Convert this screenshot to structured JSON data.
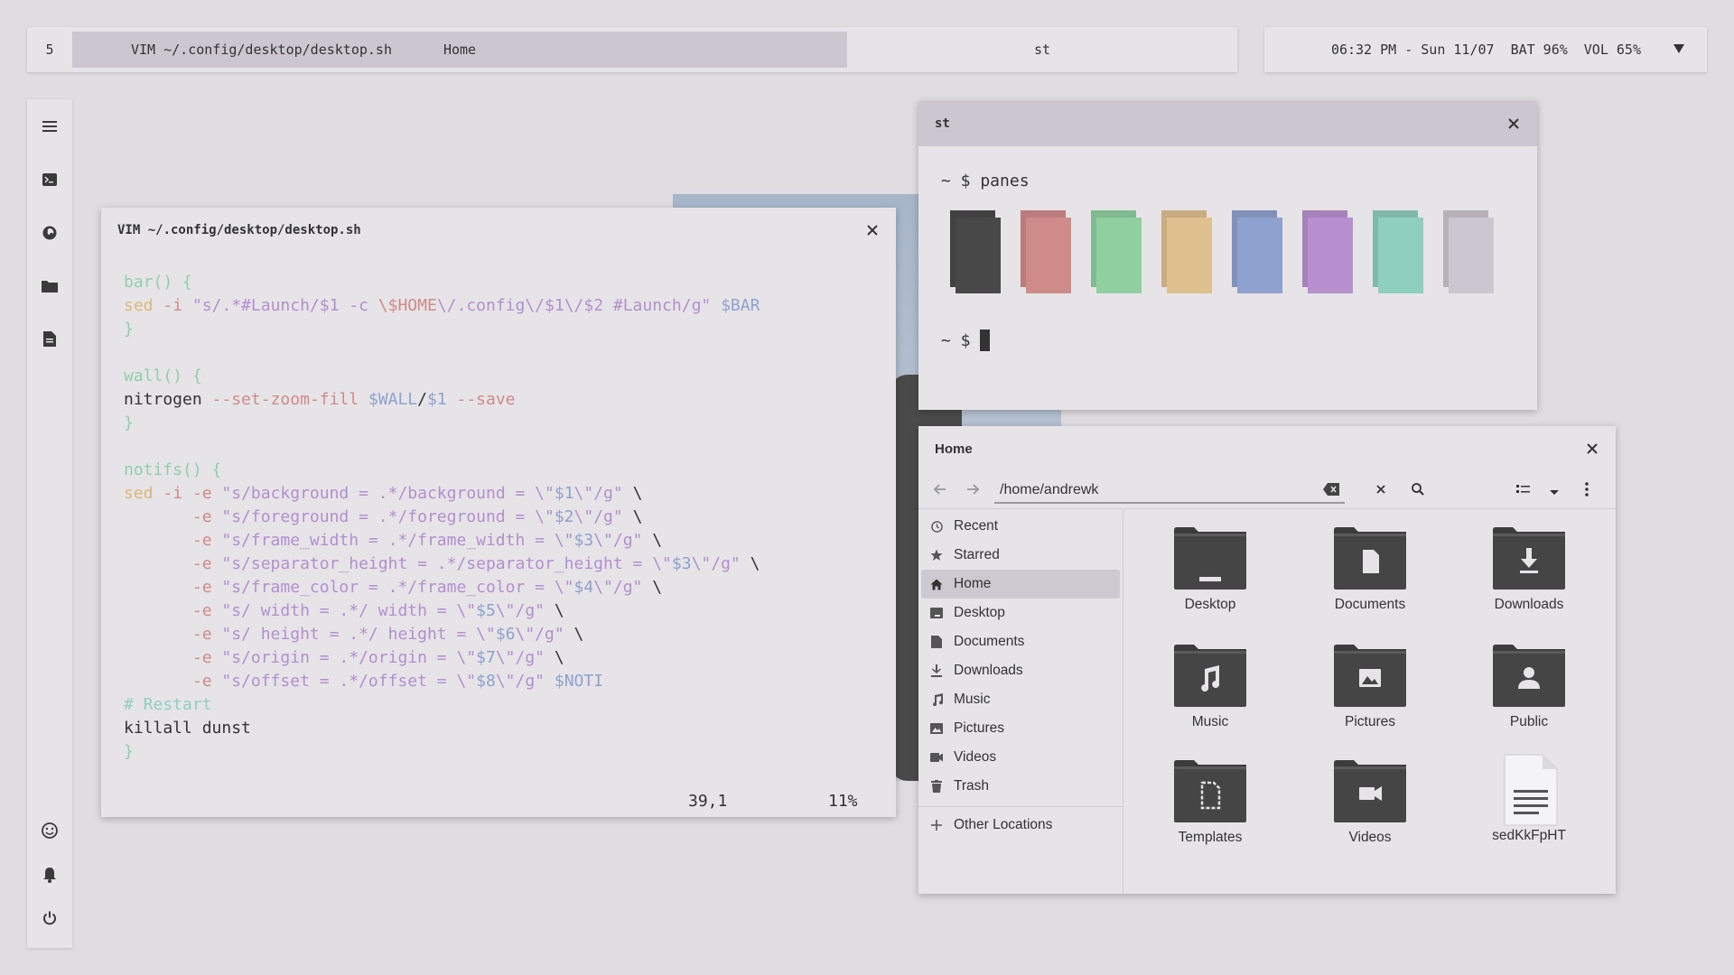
{
  "topbar": {
    "workspace": "5",
    "active_tab_left": "VIM ~/.config/desktop/desktop.sh",
    "active_tab_center": "Home",
    "tab_st": "st"
  },
  "status": {
    "datetime": "06:32 PM - Sun 11/07",
    "battery": "BAT 96%",
    "volume": "VOL 65%"
  },
  "dock": {
    "icons": [
      "menu-icon",
      "terminal-icon",
      "firefox-icon",
      "folder-icon",
      "document-icon",
      "emoji-icon",
      "bell-icon",
      "power-icon"
    ]
  },
  "vim": {
    "title": "VIM ~/.config/desktop/desktop.sh",
    "position": "39,1",
    "percent": "11%",
    "lines": [
      {
        "parts": [
          {
            "c": "green",
            "t": "bar() {"
          }
        ]
      },
      {
        "parts": [
          {
            "c": "orange",
            "t": "sed "
          },
          {
            "c": "red",
            "t": "-i "
          },
          {
            "c": "purple",
            "t": "\"s/.*#Launch/$1 -c "
          },
          {
            "c": "red",
            "t": "\\$HOME"
          },
          {
            "c": "purple",
            "t": "\\/.config\\/$1\\/$2 #Launch/g\" "
          },
          {
            "c": "blue",
            "t": "$BAR"
          }
        ]
      },
      {
        "parts": [
          {
            "c": "green",
            "t": "}"
          }
        ]
      },
      {
        "parts": [
          {
            "c": "dark",
            "t": ""
          }
        ]
      },
      {
        "parts": [
          {
            "c": "green",
            "t": "wall() {"
          }
        ]
      },
      {
        "parts": [
          {
            "c": "dark",
            "t": "nitrogen "
          },
          {
            "c": "red",
            "t": "--set-zoom-fill "
          },
          {
            "c": "blue",
            "t": "$WALL"
          },
          {
            "c": "dark",
            "t": "/"
          },
          {
            "c": "blue",
            "t": "$1 "
          },
          {
            "c": "red",
            "t": "--save"
          }
        ]
      },
      {
        "parts": [
          {
            "c": "green",
            "t": "}"
          }
        ]
      },
      {
        "parts": [
          {
            "c": "dark",
            "t": ""
          }
        ]
      },
      {
        "parts": [
          {
            "c": "green",
            "t": "notifs() {"
          }
        ]
      },
      {
        "parts": [
          {
            "c": "orange",
            "t": "sed "
          },
          {
            "c": "red",
            "t": "-i -e "
          },
          {
            "c": "purple",
            "t": "\"s/background = .*/background = \\\""
          },
          {
            "c": "blue",
            "t": "$1"
          },
          {
            "c": "purple",
            "t": "\\\"/g\" "
          },
          {
            "c": "dark",
            "t": "\\"
          }
        ]
      },
      {
        "parts": [
          {
            "c": "dark",
            "t": "       "
          },
          {
            "c": "red",
            "t": "-e "
          },
          {
            "c": "purple",
            "t": "\"s/foreground = .*/foreground = \\\""
          },
          {
            "c": "blue",
            "t": "$2"
          },
          {
            "c": "purple",
            "t": "\\\"/g\" "
          },
          {
            "c": "dark",
            "t": "\\"
          }
        ]
      },
      {
        "parts": [
          {
            "c": "dark",
            "t": "       "
          },
          {
            "c": "red",
            "t": "-e "
          },
          {
            "c": "purple",
            "t": "\"s/frame_width = .*/frame_width = \\\""
          },
          {
            "c": "blue",
            "t": "$3"
          },
          {
            "c": "purple",
            "t": "\\\"/g\" "
          },
          {
            "c": "dark",
            "t": "\\"
          }
        ]
      },
      {
        "parts": [
          {
            "c": "dark",
            "t": "       "
          },
          {
            "c": "red",
            "t": "-e "
          },
          {
            "c": "purple",
            "t": "\"s/separator_height = .*/separator_height = \\\""
          },
          {
            "c": "blue",
            "t": "$3"
          },
          {
            "c": "purple",
            "t": "\\\"/g\" "
          },
          {
            "c": "dark",
            "t": "\\"
          }
        ]
      },
      {
        "parts": [
          {
            "c": "dark",
            "t": "       "
          },
          {
            "c": "red",
            "t": "-e "
          },
          {
            "c": "purple",
            "t": "\"s/frame_color = .*/frame_color = \\\""
          },
          {
            "c": "blue",
            "t": "$4"
          },
          {
            "c": "purple",
            "t": "\\\"/g\" "
          },
          {
            "c": "dark",
            "t": "\\"
          }
        ]
      },
      {
        "parts": [
          {
            "c": "dark",
            "t": "       "
          },
          {
            "c": "red",
            "t": "-e "
          },
          {
            "c": "purple",
            "t": "\"s/ width = .*/ width = \\\""
          },
          {
            "c": "blue",
            "t": "$5"
          },
          {
            "c": "purple",
            "t": "\\\"/g\" "
          },
          {
            "c": "dark",
            "t": "\\"
          }
        ]
      },
      {
        "parts": [
          {
            "c": "dark",
            "t": "       "
          },
          {
            "c": "red",
            "t": "-e "
          },
          {
            "c": "purple",
            "t": "\"s/ height = .*/ height = \\\""
          },
          {
            "c": "blue",
            "t": "$6"
          },
          {
            "c": "purple",
            "t": "\\\"/g\" "
          },
          {
            "c": "dark",
            "t": "\\"
          }
        ]
      },
      {
        "parts": [
          {
            "c": "dark",
            "t": "       "
          },
          {
            "c": "red",
            "t": "-e "
          },
          {
            "c": "purple",
            "t": "\"s/origin = .*/origin = \\\""
          },
          {
            "c": "blue",
            "t": "$7"
          },
          {
            "c": "purple",
            "t": "\\\"/g\" "
          },
          {
            "c": "dark",
            "t": "\\"
          }
        ]
      },
      {
        "parts": [
          {
            "c": "dark",
            "t": "       "
          },
          {
            "c": "red",
            "t": "-e "
          },
          {
            "c": "purple",
            "t": "\"s/offset = .*/offset = \\\""
          },
          {
            "c": "blue",
            "t": "$8"
          },
          {
            "c": "purple",
            "t": "\\\"/g\" "
          },
          {
            "c": "blue",
            "t": "$NOTI"
          }
        ]
      },
      {
        "parts": [
          {
            "c": "teal",
            "t": "# Restart"
          }
        ]
      },
      {
        "parts": [
          {
            "c": "dark",
            "t": "killall dunst"
          }
        ]
      },
      {
        "parts": [
          {
            "c": "green",
            "t": "}"
          }
        ]
      }
    ]
  },
  "st": {
    "title": "st",
    "prompt1": "~ $ panes",
    "prompt2": "~ $",
    "pane_colors": [
      "#484848",
      "#cf8a8a",
      "#8fcfa0",
      "#dfc08f",
      "#8fa1cf",
      "#b88fcf",
      "#8fcfc0",
      "#cbc6cf"
    ]
  },
  "fm": {
    "title": "Home",
    "path": "/home/andrewk",
    "sidebar": [
      {
        "label": "Recent",
        "icon": "clock-icon"
      },
      {
        "label": "Starred",
        "icon": "star-icon"
      },
      {
        "label": "Home",
        "icon": "home-icon",
        "active": true
      },
      {
        "label": "Desktop",
        "icon": "desktop-icon"
      },
      {
        "label": "Documents",
        "icon": "documents-icon"
      },
      {
        "label": "Downloads",
        "icon": "downloads-icon"
      },
      {
        "label": "Music",
        "icon": "music-icon"
      },
      {
        "label": "Pictures",
        "icon": "pictures-icon"
      },
      {
        "label": "Videos",
        "icon": "videos-icon"
      },
      {
        "label": "Trash",
        "icon": "trash-icon"
      }
    ],
    "other_locations": "Other Locations",
    "items": [
      {
        "label": "Desktop",
        "icon": "desktop-folder-icon"
      },
      {
        "label": "Documents",
        "icon": "documents-folder-icon"
      },
      {
        "label": "Downloads",
        "icon": "downloads-folder-icon"
      },
      {
        "label": "Music",
        "icon": "music-folder-icon"
      },
      {
        "label": "Pictures",
        "icon": "pictures-folder-icon"
      },
      {
        "label": "Public",
        "icon": "public-folder-icon"
      },
      {
        "label": "Templates",
        "icon": "templates-folder-icon"
      },
      {
        "label": "Videos",
        "icon": "videos-folder-icon"
      },
      {
        "label": "sedKkFpHT",
        "icon": "text-file-icon"
      }
    ]
  }
}
